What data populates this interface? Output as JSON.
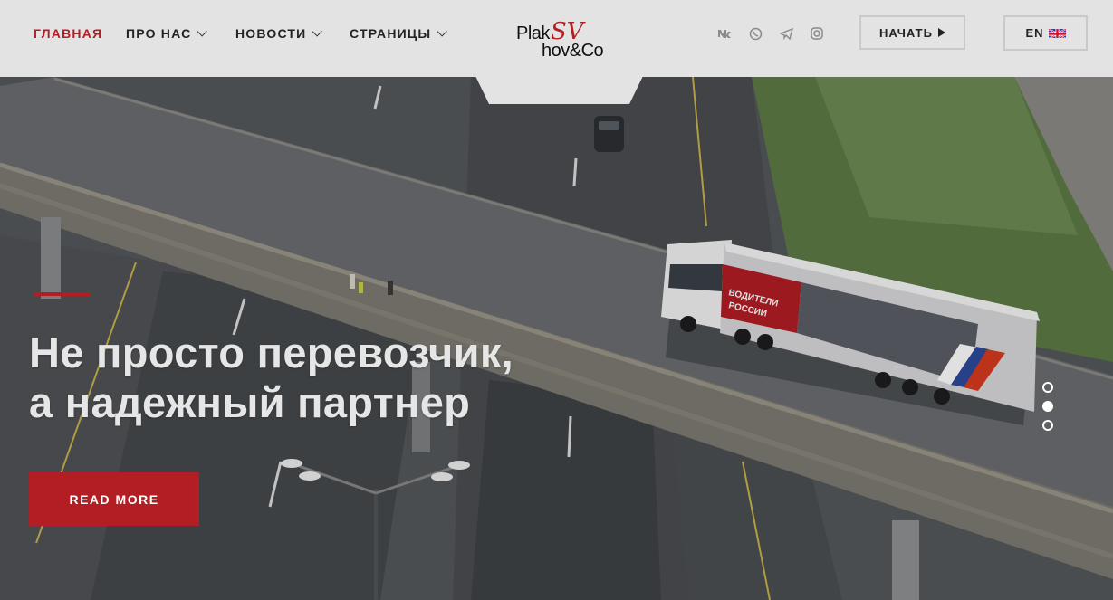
{
  "header": {
    "nav": [
      {
        "label": "ГЛАВНАЯ",
        "active": true,
        "dropdown": false
      },
      {
        "label": "ПРО НАС",
        "active": false,
        "dropdown": true
      },
      {
        "label": "НОВОСТИ",
        "active": false,
        "dropdown": true
      },
      {
        "label": "СТРАНИЦЫ",
        "active": false,
        "dropdown": true
      }
    ],
    "logo": {
      "line1": "Plak",
      "line2": "hov&Co",
      "monogram": "SV"
    },
    "social": [
      "vk-icon",
      "whatsapp-icon",
      "telegram-icon",
      "instagram-icon"
    ],
    "start_label": "НАЧАТЬ",
    "lang_label": "EN"
  },
  "hero": {
    "headline_line1": "Не просто перевозчик,",
    "headline_line2": "а надежный партнер",
    "read_more_label": "READ MORE",
    "truck_text_line1": "ВОДИТЕЛИ",
    "truck_text_line2": "РОССИИ",
    "slides": 3,
    "active_slide": 1
  },
  "colors": {
    "accent": "#b21e24",
    "header_bg": "#e3e3e3"
  }
}
